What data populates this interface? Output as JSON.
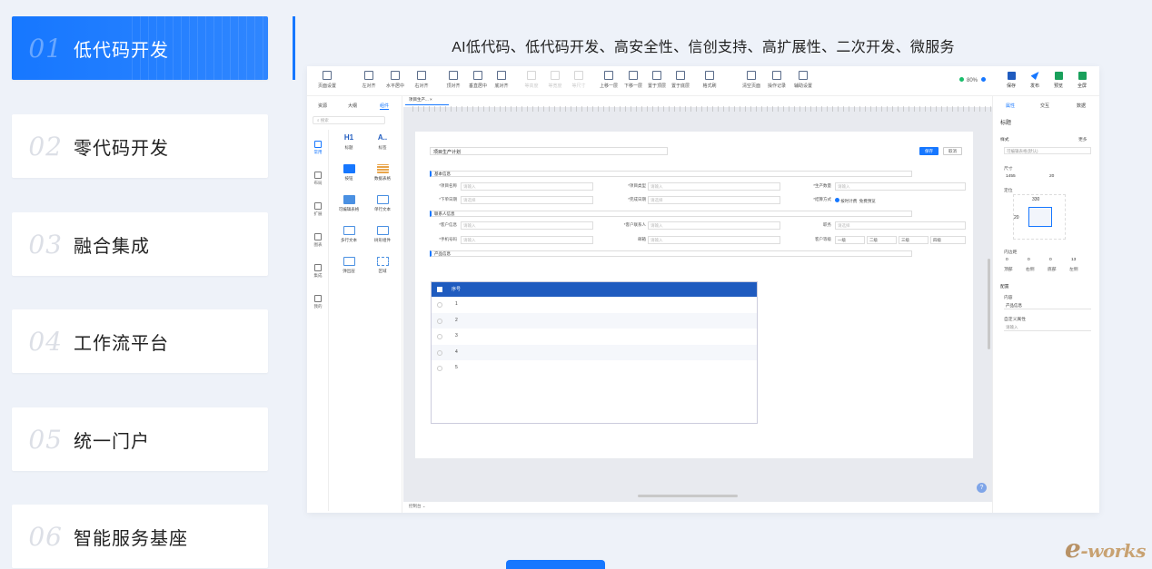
{
  "nav": [
    {
      "num": "01",
      "label": "低代码开发"
    },
    {
      "num": "02",
      "label": "零代码开发"
    },
    {
      "num": "03",
      "label": "融合集成"
    },
    {
      "num": "04",
      "label": "工作流平台"
    },
    {
      "num": "05",
      "label": "统一门户"
    },
    {
      "num": "06",
      "label": "智能服务基座"
    }
  ],
  "headline": "AI低代码、低代码开发、高安全性、信创支持、高扩展性、二次开发、微服务",
  "toolbar": {
    "page_settings": "页面设置",
    "align_left": "左对齐",
    "align_hcenter": "水平居中",
    "align_right": "右对齐",
    "align_top": "顶对齐",
    "align_vcenter": "垂直居中",
    "align_bottom": "底对齐",
    "equal_height": "等高度",
    "equal_width": "等宽度",
    "equal_size": "等尺寸",
    "move_up": "上移一层",
    "move_down": "下移一层",
    "to_top": "置于顶层",
    "to_bottom": "置于底层",
    "format_brush": "格式刷",
    "clear_page": "清空页面",
    "history": "操作记录",
    "guides": "辅助设置",
    "zoom": "80%",
    "save": "保存",
    "publish": "发布",
    "preview": "预览",
    "fullscreen": "全屏"
  },
  "sidebar": {
    "tabs": [
      "资源",
      "大纲",
      "组件"
    ],
    "search_placeholder": "搜索",
    "categories": [
      "常用",
      "布局",
      "扩展",
      "图表",
      "集成",
      "我的"
    ],
    "components": [
      "标题",
      "标签",
      "按钮",
      "数据表格",
      "可编辑表格",
      "单行文本",
      "多行文本",
      "树形组件",
      "弹出层",
      "区域"
    ]
  },
  "doc_tab": "项目生产...",
  "form": {
    "title": "项目生产计划",
    "save": "保存",
    "cancel": "取消",
    "section_basic": "基本信息",
    "project_name": "*项目名称",
    "project_type": "*项目类型",
    "product_qty": "*生产数量",
    "order_date": "*下单日期",
    "finish_date": "*完成日期",
    "settle_method": "*结算方式",
    "placeholder": "请输入",
    "placeholder_select": "请选择",
    "opt_settle_a": "按时计费",
    "opt_settle_b": "免费预览",
    "section_contact": "联系人信息",
    "customer_info": "*客户信息",
    "customer_contact": "*客户联系人",
    "position": "职务",
    "phone": "*手机号码",
    "email": "邮箱",
    "customer_level": "客户等级",
    "level_1": "一级",
    "level_2": "二级",
    "level_3": "三级",
    "level_4": "四级",
    "section_product": "产品信息",
    "table_header": "序号",
    "rows": [
      "1",
      "2",
      "3",
      "4",
      "5"
    ]
  },
  "right_panel": {
    "tabs": [
      "属性",
      "交互",
      "数据"
    ],
    "component_name": "标题",
    "style_label": "样式",
    "more": "更多",
    "table_style": "可编辑表格(默认)",
    "size_label": "尺寸",
    "width": "1455",
    "height": "20",
    "pos_label": "定位",
    "top_val": "330",
    "left_val": "20",
    "padding_label": "内边距",
    "pad_values": [
      "0",
      "0",
      "0",
      "13"
    ],
    "pad_names": [
      "顶部",
      "右侧",
      "底部",
      "左侧"
    ],
    "config_label": "配置",
    "content_label": "内容",
    "content_value": "产品信息",
    "custom_attr": "自定义属性",
    "custom_placeholder": "请输入"
  },
  "bottom_tab": "控制台",
  "brand": {
    "e": "e",
    "rest": "-works"
  }
}
